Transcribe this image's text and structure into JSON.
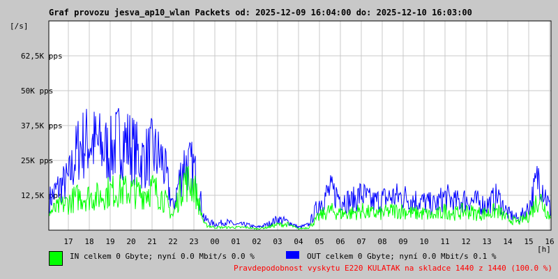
{
  "chart_data": {
    "type": "line",
    "title": "Graf provozu jesva_ap10_wlan Packets od: 2025-12-09 16:04:00 do: 2025-12-10 16:03:00",
    "ylabel": "[/s]",
    "xlabel": "[h]",
    "ylim": [
      0,
      75
    ],
    "y_ticks": [
      {
        "v": 12.5,
        "label": "12,5K pps"
      },
      {
        "v": 25,
        "label": "25K pps"
      },
      {
        "v": 37.5,
        "label": "37,5K pps"
      },
      {
        "v": 50,
        "label": "50K pps"
      },
      {
        "v": 62.5,
        "label": "62,5K pps"
      }
    ],
    "x_ticks": [
      "17",
      "18",
      "19",
      "20",
      "21",
      "22",
      "23",
      "00",
      "01",
      "02",
      "03",
      "04",
      "05",
      "06",
      "07",
      "08",
      "09",
      "10",
      "11",
      "12",
      "13",
      "14",
      "15",
      "16"
    ],
    "grid": true,
    "x_hours_from_16": [
      0,
      0.5,
      1,
      1.5,
      2,
      2.5,
      3,
      3.5,
      4,
      4.5,
      5,
      5.5,
      6,
      6.5,
      7,
      7.5,
      8,
      8.5,
      9,
      9.5,
      10,
      10.5,
      11,
      11.5,
      12,
      12.5,
      13,
      13.5,
      14,
      14.5,
      15,
      15.5,
      16,
      16.5,
      17,
      17.5,
      18,
      18.5,
      19,
      19.5,
      20,
      20.5,
      21,
      21.5,
      22,
      22.5,
      23,
      23.5,
      24
    ],
    "series": [
      {
        "name": "OUT",
        "color": "#0000ff",
        "values": [
          10,
          15,
          18,
          30,
          32,
          30,
          28,
          33,
          30,
          25,
          28,
          25,
          8,
          24,
          22,
          4,
          2,
          3,
          2,
          2,
          1,
          2,
          4,
          3,
          1,
          2,
          10,
          14,
          12,
          10,
          13,
          10,
          11,
          12,
          12,
          11,
          10,
          9,
          12,
          10,
          11,
          10,
          9,
          12,
          6,
          4,
          8,
          20,
          8
        ]
      },
      {
        "name": "IN",
        "color": "#00ff00",
        "values": [
          6,
          8,
          10,
          12,
          12,
          12,
          14,
          14,
          14,
          13,
          15,
          12,
          5,
          18,
          16,
          2,
          1,
          1,
          1,
          1,
          0.5,
          1,
          2,
          2,
          0.5,
          1,
          5,
          7,
          6,
          6,
          7,
          6,
          6,
          7,
          7,
          6,
          6,
          5,
          7,
          6,
          7,
          6,
          6,
          7,
          4,
          3,
          5,
          12,
          5
        ]
      }
    ]
  },
  "legend": {
    "in_text": "IN celkem 0 Gbyte; nyní   0.0 Mbit/s 0.0 %",
    "out_text": "OUT celkem 0 Gbyte; nyní   0.0 Mbit/s 0.1 %",
    "in_color": "#00ff00",
    "out_color": "#0000ff"
  },
  "footer": "Pravdepodobnost vyskytu E220 KULATAK na skladce 1440 z 1440 (100.0 %)"
}
